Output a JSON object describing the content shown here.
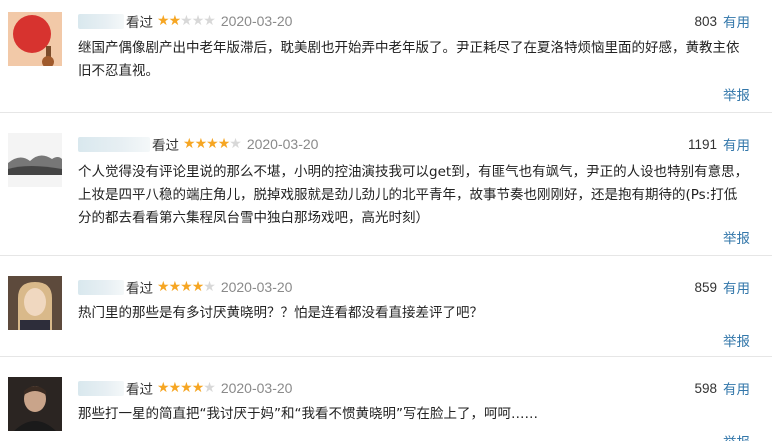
{
  "reviews": [
    {
      "seen": "看过",
      "rating": 2,
      "date": "2020-03-20",
      "votes": "803",
      "useful": "有用",
      "text": "继国产偶像剧产出中老年版滞后，耽美剧也开始弄中老年版了。尹正耗尽了在夏洛特烦恼里面的好感，黄教主依旧不忍直视。",
      "report": "举报"
    },
    {
      "seen": "看过",
      "rating": 4,
      "date": "2020-03-20",
      "votes": "1191",
      "useful": "有用",
      "text": "个人觉得没有评论里说的那么不堪，小明的控油演技我可以get到，有匪气也有飒气，尹正的人设也特别有意思，上妆是四平八稳的端庄角儿，脱掉戏服就是劲儿劲儿的北平青年，故事节奏也刚刚好，还是抱有期待的(Ps:打低分的都去看看第六集程凤台雪中独白那场戏吧，高光时刻）",
      "report": "举报"
    },
    {
      "seen": "看过",
      "rating": 4,
      "date": "2020-03-20",
      "votes": "859",
      "useful": "有用",
      "text": "热门里的那些是有多讨厌黄晓明？？怕是连看都没看直接差评了吧？",
      "report": "举报"
    },
    {
      "seen": "看过",
      "rating": 4,
      "date": "2020-03-20",
      "votes": "598",
      "useful": "有用",
      "text": "那些打一星的简直把“我讨厌于妈”和“我看不惯黄晓明”写在脸上了，呵呵……",
      "report": "举报"
    }
  ],
  "colors": {
    "link": "#3377aa",
    "star": "#f6a623",
    "star_off": "#d8d8d8"
  }
}
